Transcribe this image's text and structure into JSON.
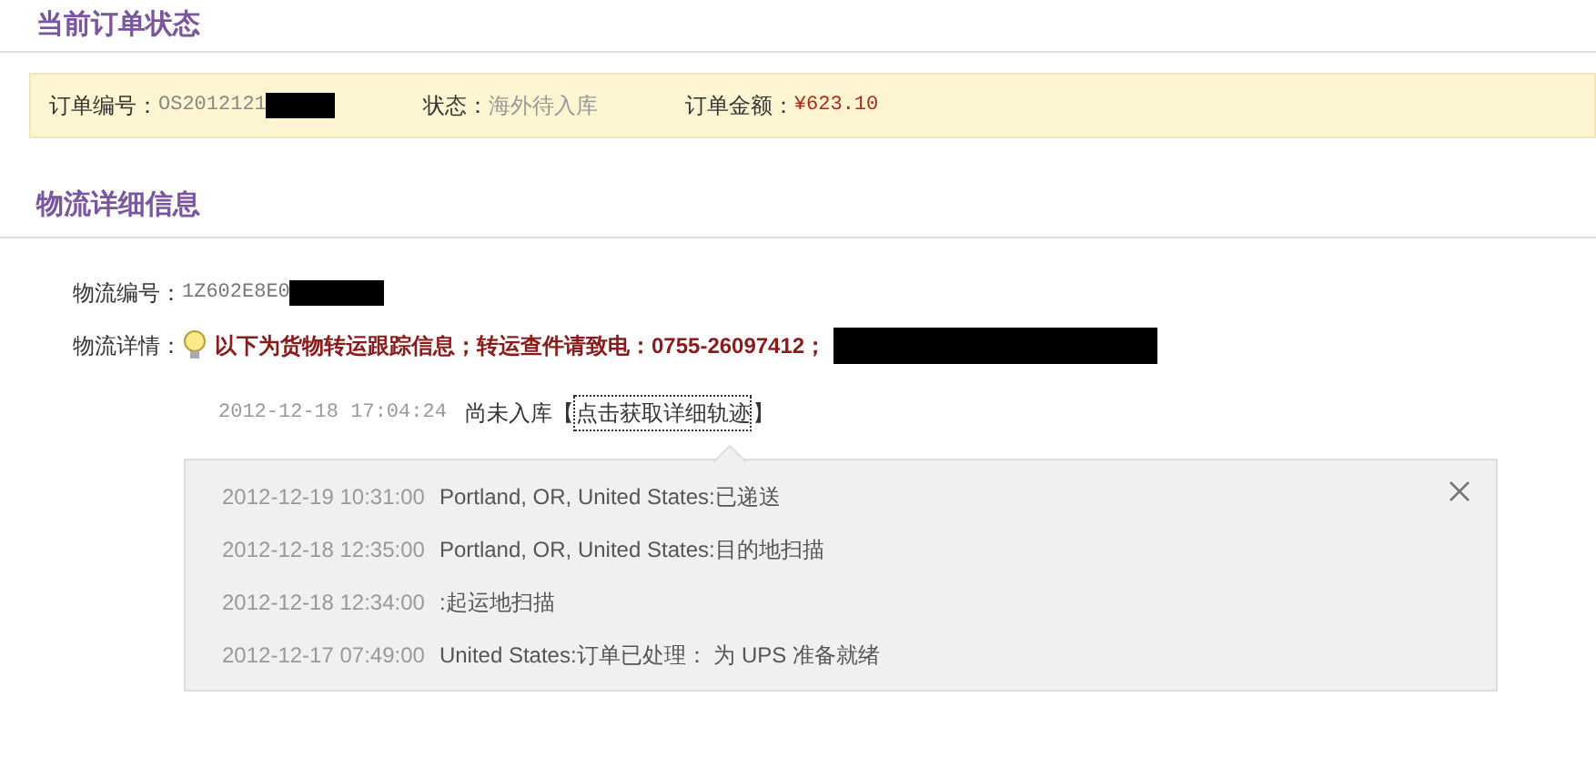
{
  "order_section": {
    "title": "当前订单状态",
    "order_no_label": "订单编号：",
    "order_no": "OS2012121",
    "status_label": "状态：",
    "status": "海外待入库",
    "amount_label": "订单金额：",
    "amount": "¥623.10"
  },
  "logistics_section": {
    "title": "物流详细信息",
    "tracking_no_label": "物流编号：",
    "tracking_no": "1Z602E8E0",
    "details_label": "物流详情：",
    "details_notice": "以下为货物转运跟踪信息；转运查件请致电：0755-26097412；",
    "latest": {
      "time": "2012-12-18 17:04:24",
      "status": "尚未入库",
      "link_open": "【",
      "link": "点击获取详细轨迹",
      "link_close": "】"
    },
    "popup": {
      "events": [
        {
          "time": "2012-12-19 10:31:00",
          "text": "Portland, OR, United States:已递送"
        },
        {
          "time": "2012-12-18 12:35:00",
          "text": "Portland, OR, United States:目的地扫描"
        },
        {
          "time": "2012-12-18 12:34:00",
          "text": ":起运地扫描"
        },
        {
          "time": "2012-12-17 07:49:00",
          "text": "United States:订单已处理： 为 UPS 准备就绪"
        }
      ]
    }
  }
}
